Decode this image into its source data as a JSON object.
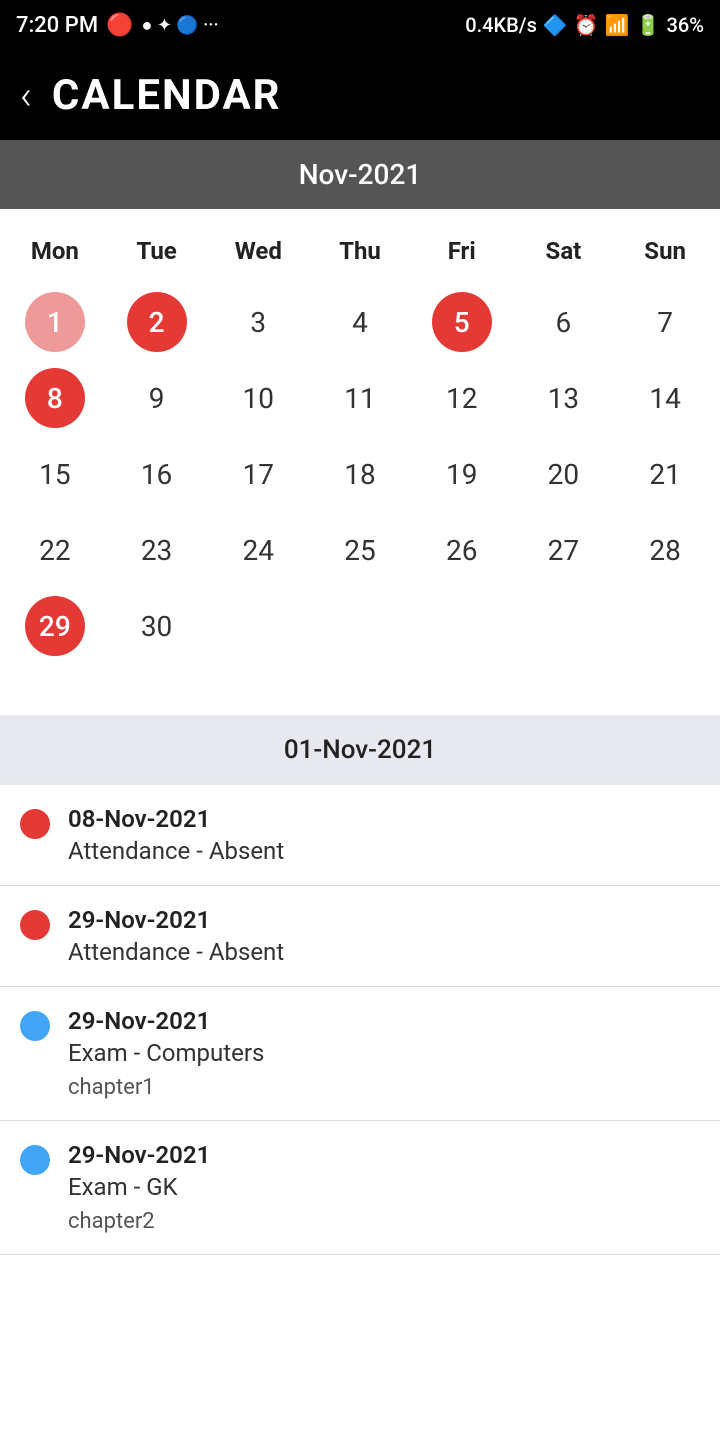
{
  "statusBar": {
    "time": "7:20 PM",
    "network": "0.4KB/s",
    "battery": "36%"
  },
  "header": {
    "title": "CALENDAR",
    "backLabel": "‹"
  },
  "calendar": {
    "monthLabel": "Nov-2021",
    "dayHeaders": [
      "Mon",
      "Tue",
      "Wed",
      "Thu",
      "Fri",
      "Sat",
      "Sun"
    ],
    "days": [
      {
        "num": "1",
        "type": "red-light-circle"
      },
      {
        "num": "2",
        "type": "red-circle"
      },
      {
        "num": "3",
        "type": "normal"
      },
      {
        "num": "4",
        "type": "normal"
      },
      {
        "num": "5",
        "type": "red-circle"
      },
      {
        "num": "6",
        "type": "normal"
      },
      {
        "num": "7",
        "type": "normal"
      },
      {
        "num": "8",
        "type": "red-circle"
      },
      {
        "num": "9",
        "type": "normal"
      },
      {
        "num": "10",
        "type": "normal"
      },
      {
        "num": "11",
        "type": "normal"
      },
      {
        "num": "12",
        "type": "normal"
      },
      {
        "num": "13",
        "type": "normal"
      },
      {
        "num": "14",
        "type": "normal"
      },
      {
        "num": "15",
        "type": "normal"
      },
      {
        "num": "16",
        "type": "normal"
      },
      {
        "num": "17",
        "type": "normal"
      },
      {
        "num": "18",
        "type": "normal"
      },
      {
        "num": "19",
        "type": "normal"
      },
      {
        "num": "20",
        "type": "normal"
      },
      {
        "num": "21",
        "type": "normal"
      },
      {
        "num": "22",
        "type": "normal"
      },
      {
        "num": "23",
        "type": "normal"
      },
      {
        "num": "24",
        "type": "normal"
      },
      {
        "num": "25",
        "type": "normal"
      },
      {
        "num": "26",
        "type": "normal"
      },
      {
        "num": "27",
        "type": "normal"
      },
      {
        "num": "28",
        "type": "normal"
      },
      {
        "num": "29",
        "type": "red-circle"
      },
      {
        "num": "30",
        "type": "normal"
      },
      {
        "num": "",
        "type": "empty"
      },
      {
        "num": "",
        "type": "empty"
      },
      {
        "num": "",
        "type": "empty"
      },
      {
        "num": "",
        "type": "empty"
      },
      {
        "num": "",
        "type": "empty"
      }
    ]
  },
  "eventsHeader": "01-Nov-2021",
  "events": [
    {
      "dotColor": "red",
      "date": "08-Nov-2021",
      "title": "Attendance - Absent",
      "subtitle": ""
    },
    {
      "dotColor": "red",
      "date": "29-Nov-2021",
      "title": "Attendance - Absent",
      "subtitle": ""
    },
    {
      "dotColor": "blue",
      "date": "29-Nov-2021",
      "title": "Exam - Computers",
      "subtitle": "chapter1"
    },
    {
      "dotColor": "blue",
      "date": "29-Nov-2021",
      "title": "Exam - GK",
      "subtitle": "chapter2"
    }
  ]
}
